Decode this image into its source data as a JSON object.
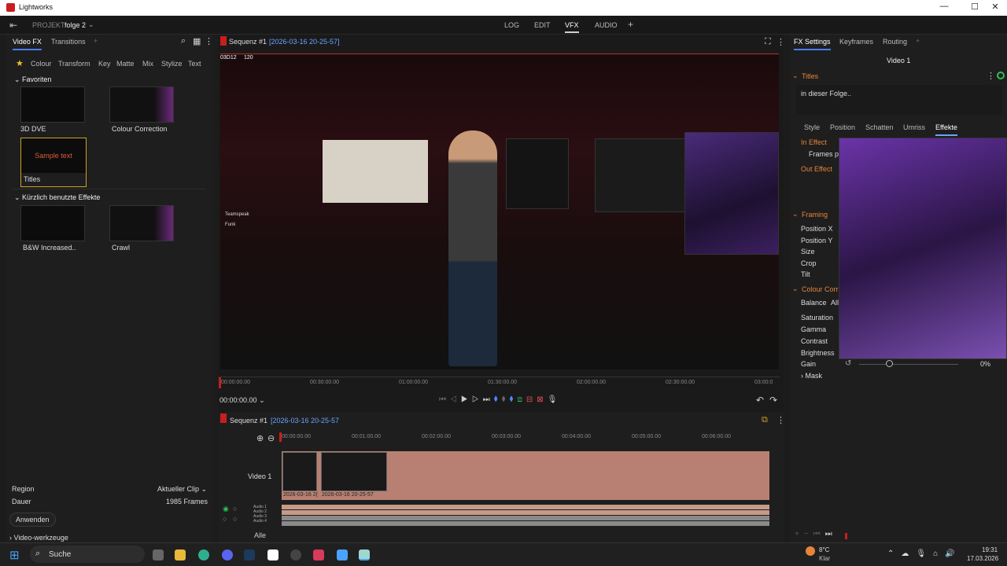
{
  "window": {
    "title": "Lightworks",
    "minimize": "—",
    "maximize": "☐",
    "close": "✕"
  },
  "topbar": {
    "project_label": "PROJEKT",
    "project_name": "folge 2",
    "modes": [
      "LOG",
      "EDIT",
      "VFX",
      "AUDIO"
    ],
    "active_mode": "VFX",
    "add": "+"
  },
  "left": {
    "tabs": [
      "Video FX",
      "Transitions"
    ],
    "add": "+",
    "categories": [
      "Colour",
      "Transform",
      "Key",
      "Matte",
      "Mix",
      "Stylize",
      "Text"
    ],
    "favorites_title": "Favoriten",
    "favorites": [
      {
        "label": "3D DVE"
      },
      {
        "label": "Colour Correction"
      },
      {
        "label": "Titles",
        "preview_text": "Sample text"
      }
    ],
    "recent_title": "Kürzlich benutzte Effekte",
    "recent": [
      {
        "label": "B&W Increased.."
      },
      {
        "label": "Crawl"
      }
    ],
    "region_label": "Region",
    "region_value": "Aktueller Clip",
    "duration_label": "Dauer",
    "duration_value": "1985 Frames",
    "apply": "Anwenden",
    "tools": "Video-werkzeuge"
  },
  "viewer": {
    "title": "Sequenz #1",
    "date": "[2026-03-16 20-25-57]",
    "overlay_left": "03D12",
    "overlay_fps": "120",
    "hud_lines": [
      "Teamspeak",
      "Funk"
    ],
    "ruler": [
      "00:00:00.00",
      "00:30:00.00",
      "01:00:00.00",
      "01:30:00.00",
      "02:00:00.00",
      "02:30:00.00",
      "03:00:0"
    ],
    "timecode": "00:00:00.00"
  },
  "timeline": {
    "title": "Sequenz #1",
    "date": "[2026-03-16 20-25-57",
    "ruler": [
      "00:00:00.00",
      "00:01:00.00",
      "00:02:00.00",
      "00:03:00.00",
      "00:04:00.00",
      "00:05:00.00",
      "00:06:00.00"
    ],
    "video_track": "Video 1",
    "clips": [
      "2026-03-16 2(",
      "2026-03-16 20-25-57"
    ],
    "audio_tracks": [
      "Audio 1",
      "Audio 2",
      "Audio 3",
      "Audio 4"
    ],
    "all": "Alle"
  },
  "right": {
    "tabs": [
      "FX Settings",
      "Keyframes",
      "Routing"
    ],
    "add": "+",
    "target": "Video 1",
    "section_titles": "Titles",
    "text_value": "in dieser Folge..",
    "subtabs": [
      "Style",
      "Position",
      "Schatten",
      "Umriss",
      "Effekte"
    ],
    "active_subtab": "Effekte",
    "in_effect": "In Effect",
    "frames": "Frames p",
    "out_effect": "Out Effect",
    "framing_title": "Framing",
    "framing": [
      "Position X",
      "Position Y",
      "Size",
      "Crop",
      "Tilt"
    ],
    "colour_title": "Colour Corr",
    "balance": "Balance",
    "balance_all": "All",
    "colour_params": [
      "Saturation",
      "Gamma",
      "Contrast",
      "Brightness",
      "Gain"
    ],
    "gain_value": "0%",
    "gain_level": 0.3,
    "mask": "Mask"
  },
  "taskbar": {
    "search": "Suche",
    "weather_temp": "8°C",
    "weather_desc": "Klar",
    "time": "19:31",
    "date": "17.03.2026"
  }
}
